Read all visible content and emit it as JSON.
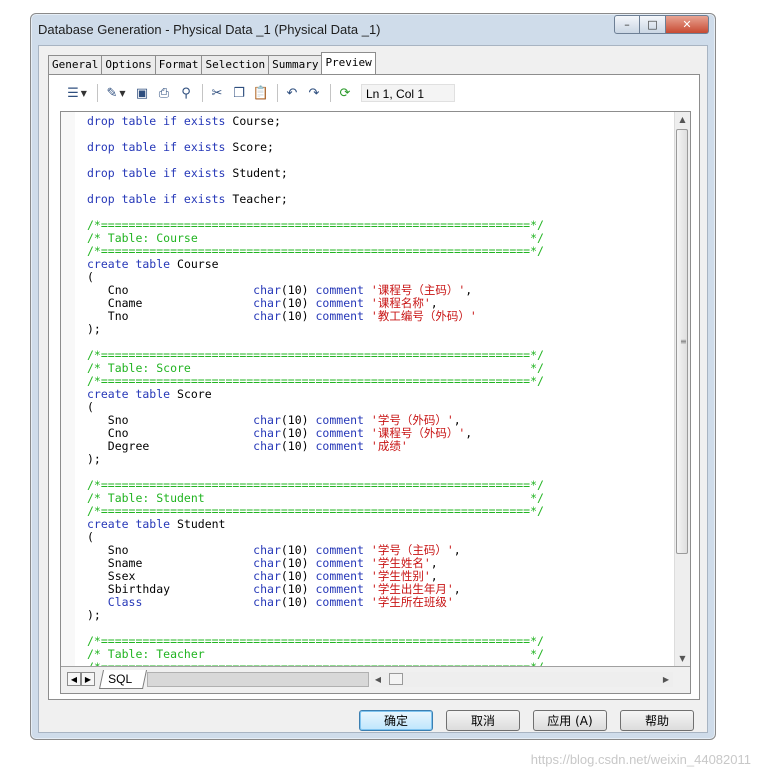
{
  "window": {
    "title": "Database Generation - Physical Data _1 (Physical Data _1)",
    "caption_min": "–",
    "caption_max": "□",
    "caption_close": "✕"
  },
  "tabs": [
    {
      "label": "General"
    },
    {
      "label": "Options"
    },
    {
      "label": "Format"
    },
    {
      "label": "Selection"
    },
    {
      "label": "Summary"
    },
    {
      "label": "Preview",
      "active": true
    }
  ],
  "toolbar": {
    "icons": [
      "properties-icon",
      "edit-icon",
      "save-icon",
      "print-icon",
      "find-icon",
      "cut-icon",
      "copy-icon",
      "paste-icon",
      "undo-icon",
      "redo-icon",
      "refresh-icon"
    ],
    "position": "Ln 1, Col 1"
  },
  "code_lines": [
    [
      [
        "kw",
        "drop table if exists "
      ],
      [
        "",
        "Course;"
      ]
    ],
    [],
    [
      [
        "kw",
        "drop table if exists "
      ],
      [
        "",
        "Score;"
      ]
    ],
    [],
    [
      [
        "kw",
        "drop table if exists "
      ],
      [
        "",
        "Student;"
      ]
    ],
    [],
    [
      [
        "kw",
        "drop table if exists "
      ],
      [
        "",
        "Teacher;"
      ]
    ],
    [],
    [
      [
        "cm",
        "/*==============================================================*/"
      ]
    ],
    [
      [
        "cm",
        "/* Table: Course                                                */"
      ]
    ],
    [
      [
        "cm",
        "/*==============================================================*/"
      ]
    ],
    [
      [
        "kw",
        "create table "
      ],
      [
        "",
        "Course"
      ]
    ],
    [
      [
        "",
        "("
      ]
    ],
    [
      [
        "",
        "   Cno                  "
      ],
      [
        "kw",
        "char"
      ],
      [
        "",
        "(10) "
      ],
      [
        "kw",
        "comment "
      ],
      [
        "st",
        "'课程号（主码）'"
      ],
      [
        "",
        ","
      ]
    ],
    [
      [
        "",
        "   Cname                "
      ],
      [
        "kw",
        "char"
      ],
      [
        "",
        "(10) "
      ],
      [
        "kw",
        "comment "
      ],
      [
        "st",
        "'课程名称'"
      ],
      [
        "",
        ","
      ]
    ],
    [
      [
        "",
        "   Tno                  "
      ],
      [
        "kw",
        "char"
      ],
      [
        "",
        "(10) "
      ],
      [
        "kw",
        "comment "
      ],
      [
        "st",
        "'教工编号（外码）'"
      ]
    ],
    [
      [
        "",
        ");"
      ]
    ],
    [],
    [
      [
        "cm",
        "/*==============================================================*/"
      ]
    ],
    [
      [
        "cm",
        "/* Table: Score                                                 */"
      ]
    ],
    [
      [
        "cm",
        "/*==============================================================*/"
      ]
    ],
    [
      [
        "kw",
        "create table "
      ],
      [
        "",
        "Score"
      ]
    ],
    [
      [
        "",
        "("
      ]
    ],
    [
      [
        "",
        "   Sno                  "
      ],
      [
        "kw",
        "char"
      ],
      [
        "",
        "(10) "
      ],
      [
        "kw",
        "comment "
      ],
      [
        "st",
        "'学号（外码）'"
      ],
      [
        "",
        ","
      ]
    ],
    [
      [
        "",
        "   Cno                  "
      ],
      [
        "kw",
        "char"
      ],
      [
        "",
        "(10) "
      ],
      [
        "kw",
        "comment "
      ],
      [
        "st",
        "'课程号（外码）'"
      ],
      [
        "",
        ","
      ]
    ],
    [
      [
        "",
        "   Degree               "
      ],
      [
        "kw",
        "char"
      ],
      [
        "",
        "(10) "
      ],
      [
        "kw",
        "comment "
      ],
      [
        "st",
        "'成绩'"
      ]
    ],
    [
      [
        "",
        ");"
      ]
    ],
    [],
    [
      [
        "cm",
        "/*==============================================================*/"
      ]
    ],
    [
      [
        "cm",
        "/* Table: Student                                               */"
      ]
    ],
    [
      [
        "cm",
        "/*==============================================================*/"
      ]
    ],
    [
      [
        "kw",
        "create table "
      ],
      [
        "",
        "Student"
      ]
    ],
    [
      [
        "",
        "("
      ]
    ],
    [
      [
        "",
        "   Sno                  "
      ],
      [
        "kw",
        "char"
      ],
      [
        "",
        "(10) "
      ],
      [
        "kw",
        "comment "
      ],
      [
        "st",
        "'学号（主码）'"
      ],
      [
        "",
        ","
      ]
    ],
    [
      [
        "",
        "   Sname                "
      ],
      [
        "kw",
        "char"
      ],
      [
        "",
        "(10) "
      ],
      [
        "kw",
        "comment "
      ],
      [
        "st",
        "'学生姓名'"
      ],
      [
        "",
        ","
      ]
    ],
    [
      [
        "",
        "   Ssex                 "
      ],
      [
        "kw",
        "char"
      ],
      [
        "",
        "(10) "
      ],
      [
        "kw",
        "comment "
      ],
      [
        "st",
        "'学生性别'"
      ],
      [
        "",
        ","
      ]
    ],
    [
      [
        "",
        "   Sbirthday            "
      ],
      [
        "kw",
        "char"
      ],
      [
        "",
        "(10) "
      ],
      [
        "kw",
        "comment "
      ],
      [
        "st",
        "'学生出生年月'"
      ],
      [
        "",
        ","
      ]
    ],
    [
      [
        "kw",
        "   Class                "
      ],
      [
        "kw",
        "char"
      ],
      [
        "",
        "(10) "
      ],
      [
        "kw",
        "comment "
      ],
      [
        "st",
        "'学生所在班级'"
      ]
    ],
    [
      [
        "",
        ");"
      ]
    ],
    [],
    [
      [
        "cm",
        "/*==============================================================*/"
      ]
    ],
    [
      [
        "cm",
        "/* Table: Teacher                                               */"
      ]
    ],
    [
      [
        "cm",
        "/*==============================================================*/"
      ]
    ]
  ],
  "bottom_tab": "SQL",
  "buttons": {
    "ok": "确定",
    "cancel": "取消",
    "apply": "应用 (A)",
    "help": "帮助"
  },
  "watermark": "https://blog.csdn.net/weixin_44082011"
}
